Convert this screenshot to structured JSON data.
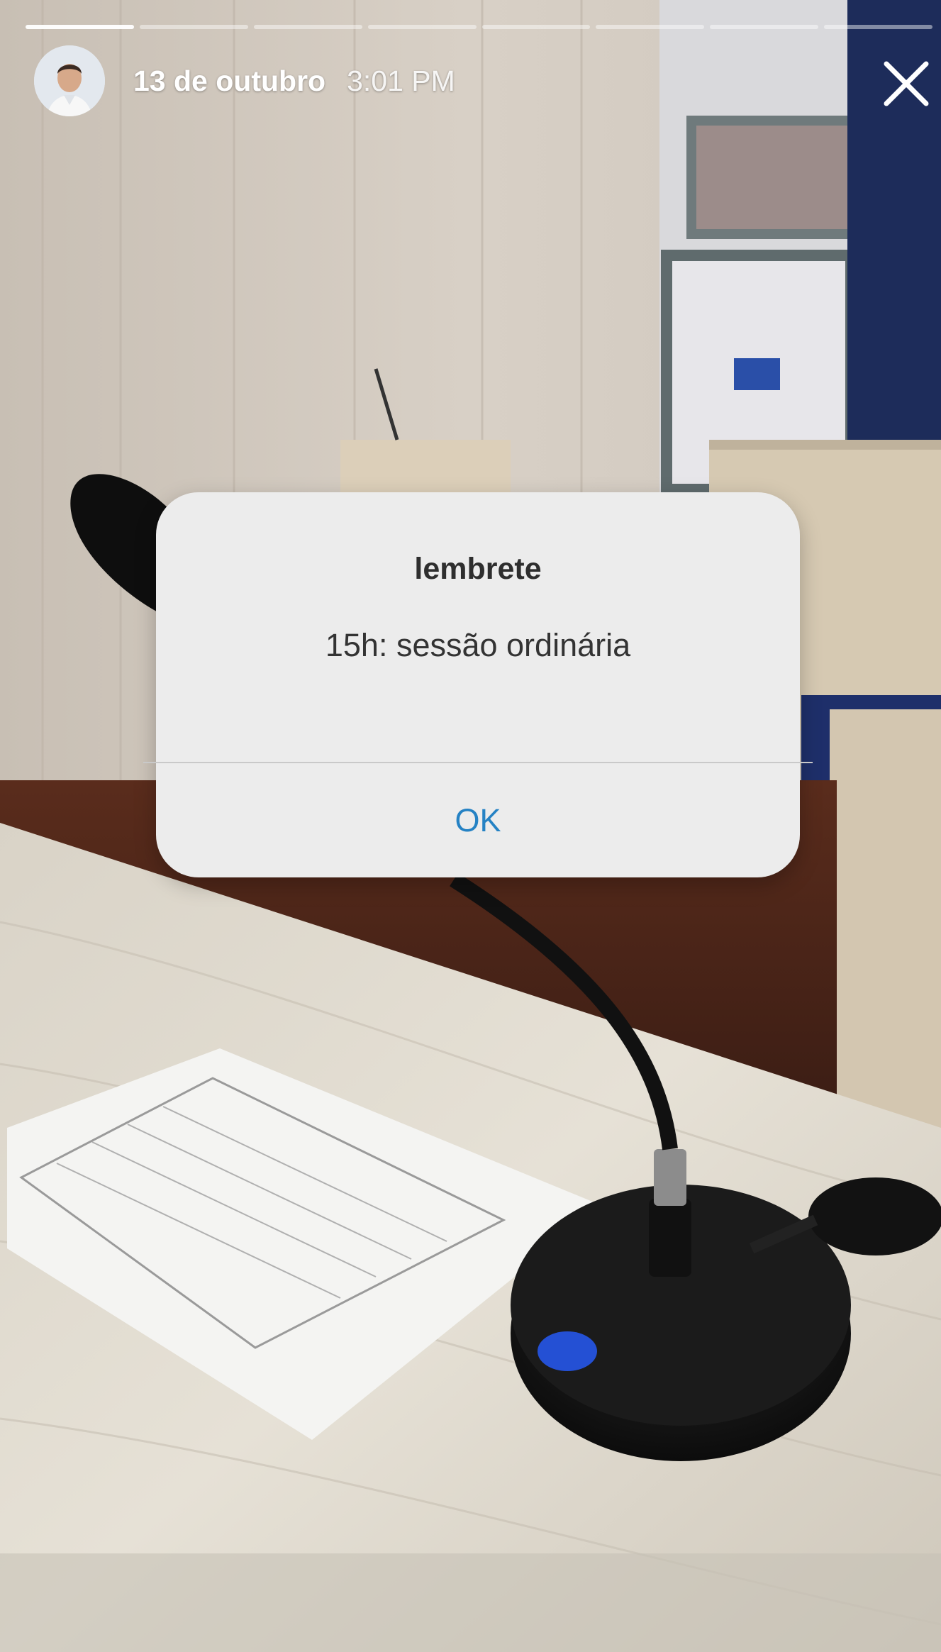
{
  "story": {
    "date": "13 de outubro",
    "time": "3:01 PM",
    "progress_segments": 8,
    "active_segment": 1
  },
  "dialog": {
    "title": "lembrete",
    "message": "15h: sessão ordinária",
    "ok_label": "OK"
  },
  "icons": {
    "close": "close-icon",
    "avatar": "avatar"
  },
  "colors": {
    "dialog_bg": "#ececec",
    "ok_text": "#2582c4",
    "progress_active": "#ffffff"
  }
}
